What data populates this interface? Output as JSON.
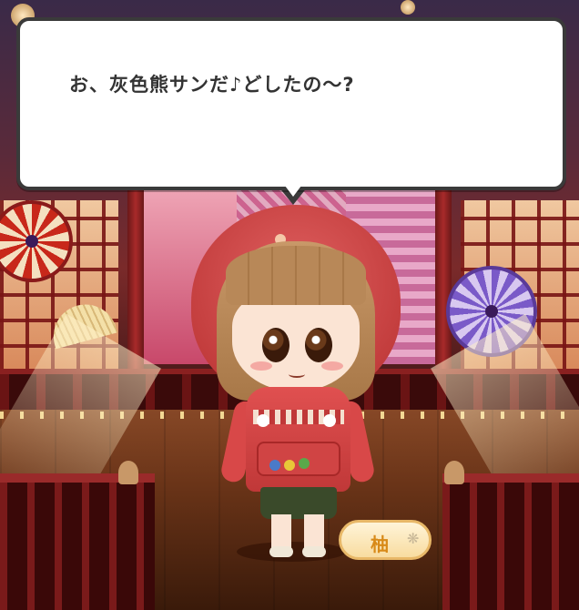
{
  "dialogue": {
    "text": "お、灰色熊サンだ♪どしたの～?"
  },
  "nameplate": {
    "label": "柚",
    "icon": "sparkle-icon"
  },
  "colors": {
    "dialog_bg": "#ffffff",
    "dialog_border": "#3a3a3a",
    "nameplate_text": "#d88a18",
    "stage_red": "#8a2020"
  }
}
